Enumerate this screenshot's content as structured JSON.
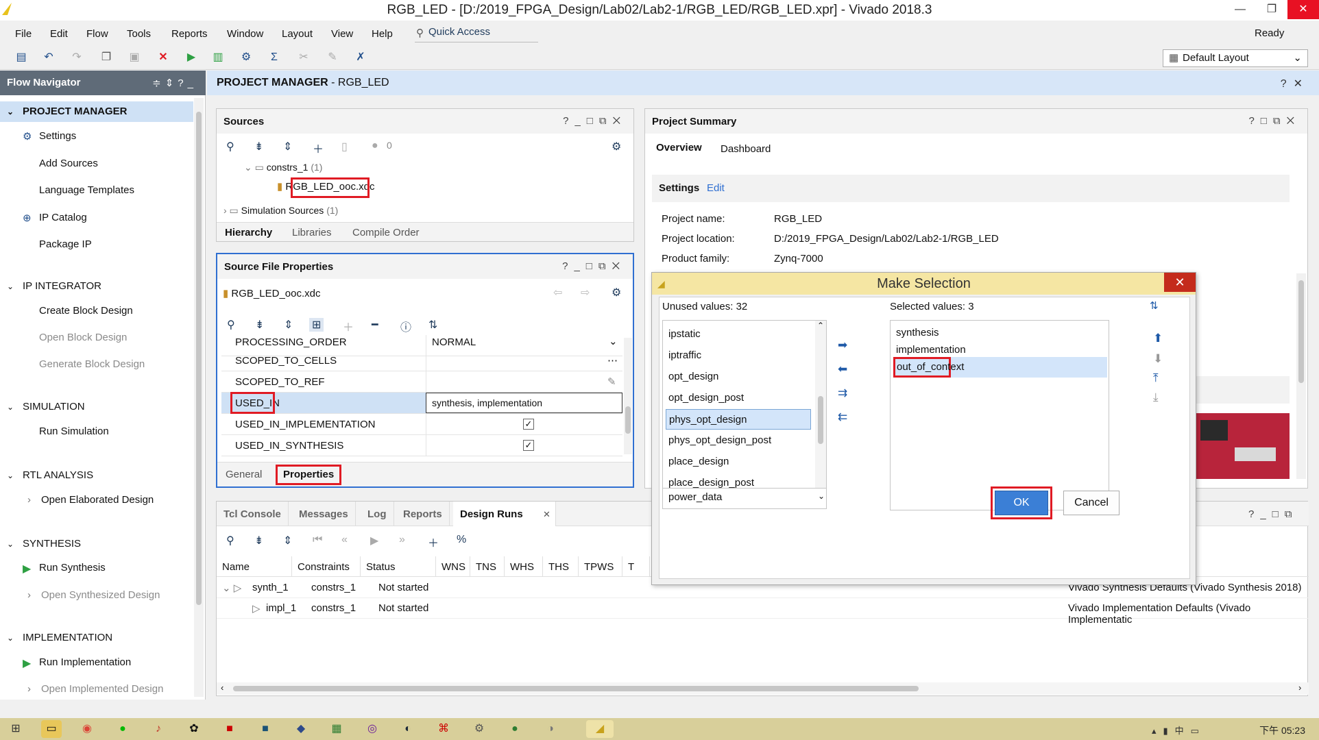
{
  "window": {
    "title": "RGB_LED - [D:/2019_FPGA_Design/Lab02/Lab2-1/RGB_LED/RGB_LED.xpr] - Vivado 2018.3",
    "min": "—",
    "max": "❐",
    "close": "✕"
  },
  "menu": [
    "File",
    "Edit",
    "Flow",
    "Tools",
    "Reports",
    "Window",
    "Layout",
    "View",
    "Help"
  ],
  "quick_access": "Quick Access",
  "status": "Ready",
  "layout_select": "Default Layout",
  "flow_navigator": {
    "title": "Flow Navigator",
    "sections": [
      {
        "label": "PROJECT MANAGER",
        "items": [
          "Settings",
          "Add Sources",
          "Language Templates",
          "IP Catalog",
          "Package IP"
        ]
      },
      {
        "label": "IP INTEGRATOR",
        "items": [
          "Create Block Design",
          "Open Block Design",
          "Generate Block Design"
        ]
      },
      {
        "label": "SIMULATION",
        "items": [
          "Run Simulation"
        ]
      },
      {
        "label": "RTL ANALYSIS",
        "items": [
          "Open Elaborated Design"
        ]
      },
      {
        "label": "SYNTHESIS",
        "items": [
          "Run Synthesis",
          "Open Synthesized Design"
        ]
      },
      {
        "label": "IMPLEMENTATION",
        "items": [
          "Run Implementation",
          "Open Implemented Design"
        ]
      }
    ]
  },
  "main_header": {
    "bold": "PROJECT MANAGER",
    "rest": " - RGB_LED"
  },
  "sources": {
    "title": "Sources",
    "count": "0",
    "tree": [
      {
        "label": "constrs_1",
        "count": "(1)"
      },
      {
        "label": "RGB_LED_ooc.xdc"
      },
      {
        "label": "Simulation Sources",
        "count": "(1)"
      }
    ],
    "tabs": [
      "Hierarchy",
      "Libraries",
      "Compile Order"
    ]
  },
  "source_props": {
    "title": "Source File Properties",
    "file": "RGB_LED_ooc.xdc",
    "rows": [
      {
        "name": "PROCESSING_ORDER",
        "value": "NORMAL"
      },
      {
        "name": "SCOPED_TO_CELLS",
        "value": ""
      },
      {
        "name": "SCOPED_TO_REF",
        "value": ""
      },
      {
        "name": "USED_IN",
        "value": "synthesis, implementation"
      },
      {
        "name": "USED_IN_IMPLEMENTATION",
        "value": "✓"
      },
      {
        "name": "USED_IN_SYNTHESIS",
        "value": "✓"
      }
    ],
    "tabs": [
      "General",
      "Properties"
    ]
  },
  "summary": {
    "title": "Project Summary",
    "tabs": [
      "Overview",
      "Dashboard"
    ],
    "settings_label": "Settings",
    "edit_label": "Edit",
    "fields": [
      {
        "key": "Project name:",
        "value": "RGB_LED"
      },
      {
        "key": "Project location:",
        "value": "D:/2019_FPGA_Design/Lab02/Lab2-1/RGB_LED"
      },
      {
        "key": "Product family:",
        "value": "Zynq-7000"
      }
    ]
  },
  "console": {
    "tabs": [
      "Tcl Console",
      "Messages",
      "Log",
      "Reports",
      "Design Runs"
    ],
    "columns": [
      "Name",
      "Constraints",
      "Status",
      "WNS",
      "TNS",
      "WHS",
      "THS",
      "TPWS",
      "T"
    ],
    "rows": [
      {
        "name": "synth_1",
        "constraints": "constrs_1",
        "status": "Not started",
        "strategy": "Vivado Synthesis Defaults (Vivado Synthesis 2018)"
      },
      {
        "name": "impl_1",
        "constraints": "constrs_1",
        "status": "Not started",
        "strategy": "Vivado Implementation Defaults (Vivado Implementatic"
      }
    ]
  },
  "dialog": {
    "title": "Make Selection",
    "unused_label": "Unused values: 32",
    "selected_label": "Selected values: 3",
    "unused": [
      "ipstatic",
      "iptraffic",
      "opt_design",
      "opt_design_post",
      "phys_opt_design",
      "phys_opt_design_post",
      "place_design",
      "place_design_post",
      "power_data"
    ],
    "selected": [
      "synthesis",
      "implementation",
      "out_of_context"
    ],
    "ok": "OK",
    "cancel": "Cancel"
  },
  "taskbar": {
    "clock": "下午 05:23"
  },
  "colors": {
    "accent": "#3b7fd6",
    "highlight": "#e01b24",
    "nav_header": "#5f6b78"
  }
}
